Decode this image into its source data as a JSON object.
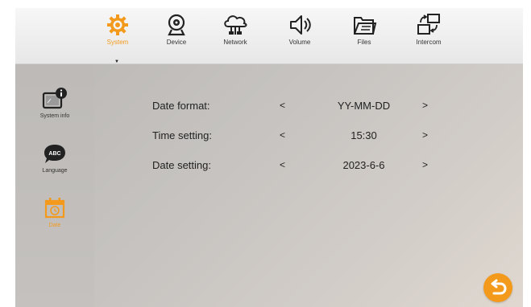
{
  "colors": {
    "accent": "#f39a1d",
    "text": "#222222"
  },
  "tabs": [
    {
      "label": "System",
      "icon": "gear-icon",
      "active": true
    },
    {
      "label": "Device",
      "icon": "webcam-icon",
      "active": false
    },
    {
      "label": "Network",
      "icon": "cloud-network-icon",
      "active": false
    },
    {
      "label": "Volume",
      "icon": "speaker-icon",
      "active": false
    },
    {
      "label": "Files",
      "icon": "folder-icon",
      "active": false
    },
    {
      "label": "Intercom",
      "icon": "intercom-icon",
      "active": false
    }
  ],
  "active_caret": "▼",
  "sidebar": {
    "items": [
      {
        "label": "System info",
        "icon": "system-info-icon",
        "active": false
      },
      {
        "label": "Language",
        "icon": "language-icon",
        "active": false
      },
      {
        "label": "Date",
        "icon": "calendar-icon",
        "active": true
      }
    ]
  },
  "settings": [
    {
      "label": "Date format:",
      "prev": "<",
      "value": "YY-MM-DD",
      "next": ">"
    },
    {
      "label": "Time setting:",
      "prev": "<",
      "value": "15:30",
      "next": ">"
    },
    {
      "label": "Date setting:",
      "prev": "<",
      "value": "2023-6-6",
      "next": ">"
    }
  ],
  "back_icon": "back-arrow-icon"
}
